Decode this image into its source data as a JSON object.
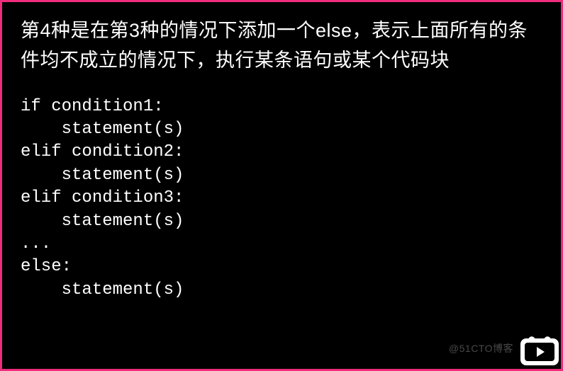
{
  "description": "第4种是在第3种的情况下添加一个else，表示上面所有的条件均不成立的情况下，执行某条语句或某个代码块",
  "code": "if condition1:\n    statement(s)\nelif condition2:\n    statement(s)\nelif condition3:\n    statement(s)\n...\nelse:\n    statement(s)",
  "watermark": "@51CTO博客"
}
